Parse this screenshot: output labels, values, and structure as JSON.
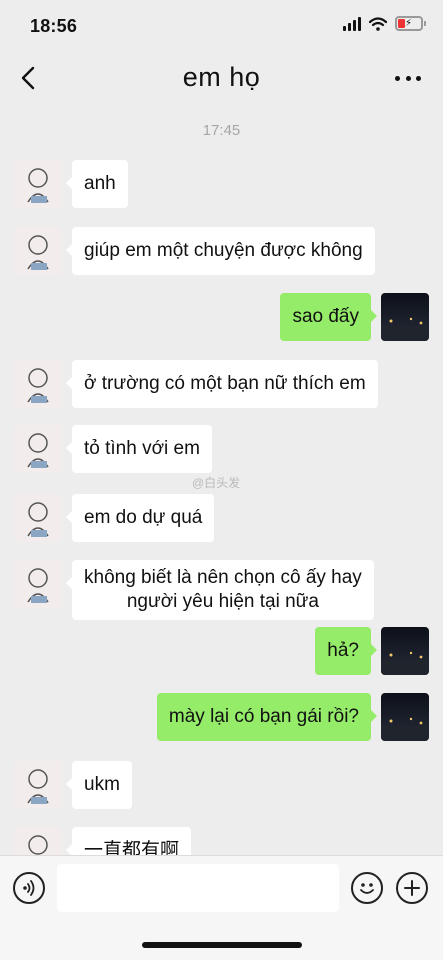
{
  "status_bar": {
    "time": "18:56"
  },
  "header": {
    "title": "em họ",
    "back_icon": "chevron-left-icon",
    "more_icon": "more-dots-icon"
  },
  "chat": {
    "timestamp": "17:45",
    "watermark": "@白头发",
    "messages": [
      {
        "side": "left",
        "text": "anh"
      },
      {
        "side": "left",
        "text": "giúp em một chuyện được không"
      },
      {
        "side": "right",
        "text": "sao đấy"
      },
      {
        "side": "left",
        "text": "ở trường có một bạn nữ thích em"
      },
      {
        "side": "left",
        "text": "tỏ tình với em"
      },
      {
        "side": "left",
        "text": "em do dự quá"
      },
      {
        "side": "left",
        "line1": "không biết là nên chọn cô ấy hay",
        "line2": "người yêu hiện tại nữa"
      },
      {
        "side": "right",
        "text": "hả?"
      },
      {
        "side": "right",
        "text": "mày lại có bạn gái rồi?"
      },
      {
        "side": "left",
        "text": "ukm"
      },
      {
        "side": "left",
        "text": "一直都有啊"
      }
    ]
  },
  "input_bar": {
    "placeholder": "",
    "voice_icon": "voice-icon",
    "emoji_icon": "emoji-icon",
    "plus_icon": "plus-icon"
  },
  "colors": {
    "background": "#ededed",
    "sent_bubble": "#95ec69",
    "received_bubble": "#ffffff"
  }
}
